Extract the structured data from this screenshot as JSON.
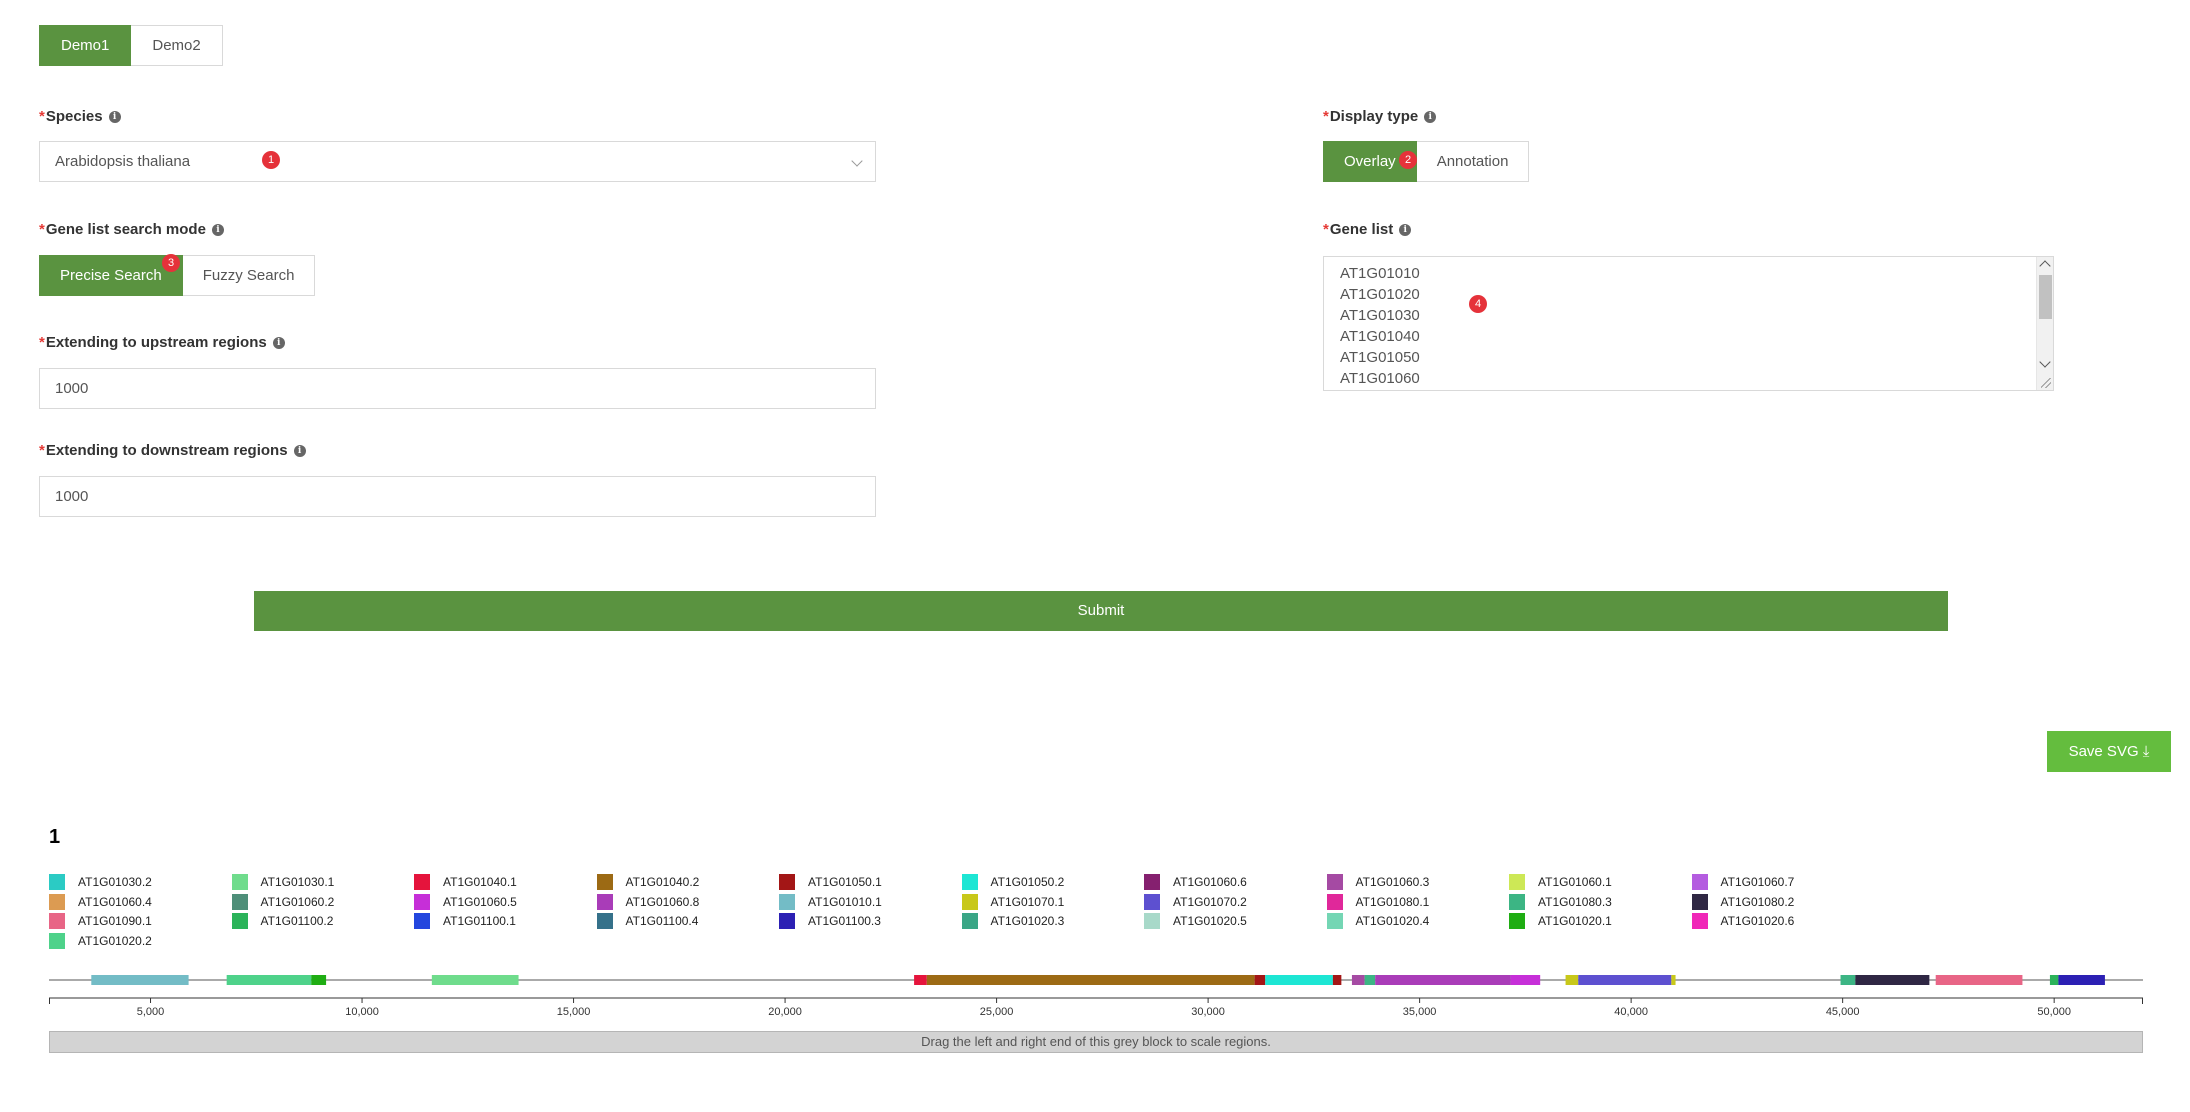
{
  "tabs": [
    {
      "label": "Demo1",
      "active": true
    },
    {
      "label": "Demo2",
      "active": false
    }
  ],
  "form": {
    "required_mark": "*",
    "info_glyph": "i",
    "species": {
      "label": "Species",
      "value": "Arabidopsis thaliana",
      "badge": "1"
    },
    "display_type": {
      "label": "Display type",
      "options": [
        "Overlay",
        "Annotation"
      ],
      "selected": "Overlay",
      "badge": "2"
    },
    "search_mode": {
      "label": "Gene list search mode",
      "options": [
        "Precise Search",
        "Fuzzy Search"
      ],
      "selected": "Precise Search",
      "badge": "3"
    },
    "gene_list": {
      "label": "Gene list",
      "lines": [
        "AT1G01010",
        "AT1G01020",
        "AT1G01030",
        "AT1G01040",
        "AT1G01050",
        "AT1G01060"
      ],
      "badge": "4"
    },
    "upstream": {
      "label": "Extending to upstream regions",
      "value": "1000"
    },
    "downstream": {
      "label": "Extending to downstream regions",
      "value": "1000"
    },
    "submit_label": "Submit"
  },
  "save_svg_label": "Save SVG ⤓",
  "chart_data": {
    "type": "gene-track",
    "title": "1",
    "legend": [
      {
        "name": "AT1G01030.2",
        "color": "#2bcbc4"
      },
      {
        "name": "AT1G01030.1",
        "color": "#6fdc8c"
      },
      {
        "name": "AT1G01040.1",
        "color": "#e5143c"
      },
      {
        "name": "AT1G01040.2",
        "color": "#9c6a14"
      },
      {
        "name": "AT1G01050.1",
        "color": "#a31616"
      },
      {
        "name": "AT1G01050.2",
        "color": "#1de6d4"
      },
      {
        "name": "AT1G01060.6",
        "color": "#85206f"
      },
      {
        "name": "AT1G01060.3",
        "color": "#a54aa3"
      },
      {
        "name": "AT1G01060.1",
        "color": "#cde856"
      },
      {
        "name": "AT1G01060.7",
        "color": "#b45ce0"
      },
      {
        "name": "AT1G01060.4",
        "color": "#dc9b52"
      },
      {
        "name": "AT1G01060.2",
        "color": "#4e8f79"
      },
      {
        "name": "AT1G01060.5",
        "color": "#c62fd8"
      },
      {
        "name": "AT1G01060.8",
        "color": "#a93cb8"
      },
      {
        "name": "AT1G01010.1",
        "color": "#73bcc6"
      },
      {
        "name": "AT1G01070.1",
        "color": "#c8c81a"
      },
      {
        "name": "AT1G01070.2",
        "color": "#5d50d0"
      },
      {
        "name": "AT1G01080.1",
        "color": "#e0289a"
      },
      {
        "name": "AT1G01080.3",
        "color": "#3cb584"
      },
      {
        "name": "AT1G01080.2",
        "color": "#2f2744"
      },
      {
        "name": "AT1G01090.1",
        "color": "#e86586"
      },
      {
        "name": "AT1G01100.2",
        "color": "#2bb35a"
      },
      {
        "name": "AT1G01100.1",
        "color": "#2346de"
      },
      {
        "name": "AT1G01100.4",
        "color": "#35718a"
      },
      {
        "name": "AT1G01100.3",
        "color": "#2c20b4"
      },
      {
        "name": "AT1G01020.3",
        "color": "#3aa686"
      },
      {
        "name": "AT1G01020.5",
        "color": "#a8d9c9"
      },
      {
        "name": "AT1G01020.4",
        "color": "#74d6b4"
      },
      {
        "name": "AT1G01020.1",
        "color": "#1fad13"
      },
      {
        "name": "AT1G01020.6",
        "color": "#f027b8"
      },
      {
        "name": "AT1G01020.2",
        "color": "#4ed28a"
      }
    ],
    "x_range": [
      2600,
      52100
    ],
    "x_ticks": [
      5000,
      10000,
      15000,
      20000,
      25000,
      30000,
      35000,
      40000,
      45000,
      50000
    ],
    "features": [
      {
        "start": 3600,
        "end": 5900,
        "color": "#73bcc6"
      },
      {
        "start": 6800,
        "end": 8800,
        "color": "#4ed28a"
      },
      {
        "start": 8800,
        "end": 9150,
        "color": "#1fad13"
      },
      {
        "start": 11650,
        "end": 13700,
        "color": "#6fdc8c"
      },
      {
        "start": 23050,
        "end": 23350,
        "color": "#e5143c"
      },
      {
        "start": 23350,
        "end": 31100,
        "color": "#9c6a14"
      },
      {
        "start": 31100,
        "end": 31350,
        "color": "#a31616"
      },
      {
        "start": 31350,
        "end": 32950,
        "color": "#1de6d4"
      },
      {
        "start": 32950,
        "end": 33150,
        "color": "#a31616"
      },
      {
        "start": 33400,
        "end": 33700,
        "color": "#a54aa3"
      },
      {
        "start": 33700,
        "end": 33950,
        "color": "#3cb584"
      },
      {
        "start": 33950,
        "end": 37150,
        "color": "#a93cb8"
      },
      {
        "start": 37150,
        "end": 37850,
        "color": "#c62fd8"
      },
      {
        "start": 38450,
        "end": 38750,
        "color": "#c8c81a"
      },
      {
        "start": 38750,
        "end": 40950,
        "color": "#5d50d0"
      },
      {
        "start": 40950,
        "end": 41050,
        "color": "#c8c81a"
      },
      {
        "start": 44950,
        "end": 45300,
        "color": "#3cb584"
      },
      {
        "start": 45300,
        "end": 47050,
        "color": "#2f2744"
      },
      {
        "start": 47200,
        "end": 49250,
        "color": "#e86586"
      },
      {
        "start": 49900,
        "end": 50100,
        "color": "#2bb35a"
      },
      {
        "start": 50100,
        "end": 51200,
        "color": "#2c20b4"
      }
    ],
    "drag_hint": "Drag the left and right end of this grey block to scale regions."
  }
}
